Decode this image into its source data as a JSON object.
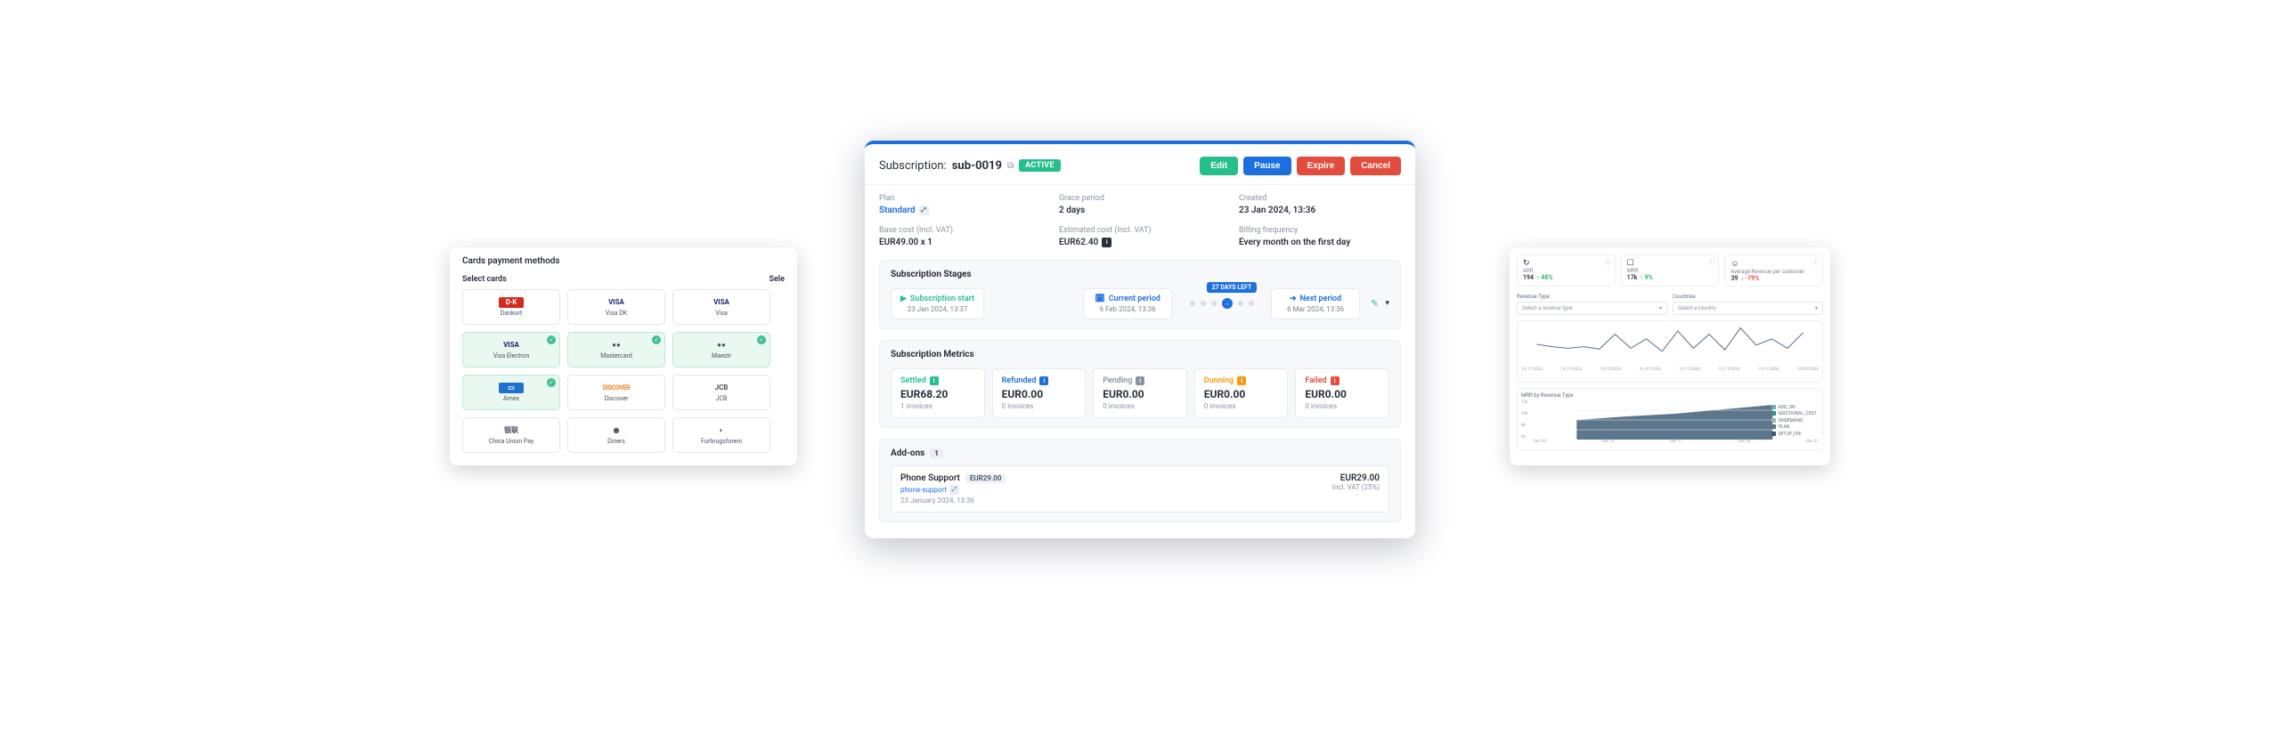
{
  "left_panel": {
    "title": "Cards payment methods",
    "select_left": "Select cards",
    "select_right": "Sele",
    "cards": [
      {
        "name": "Dankort",
        "brand": "dk",
        "selected": false
      },
      {
        "name": "Visa DK",
        "brand": "visa",
        "selected": false
      },
      {
        "name": "Visa",
        "brand": "visa",
        "selected": false,
        "cut": true
      },
      {
        "name": "Visa Electron",
        "brand": "visa",
        "selected": true
      },
      {
        "name": "Mastercard",
        "brand": "mc",
        "selected": true
      },
      {
        "name": "Maestr",
        "brand": "maestro",
        "selected": true,
        "cut": true
      },
      {
        "name": "Amex",
        "brand": "amex",
        "selected": true
      },
      {
        "name": "Discover",
        "brand": "disc",
        "selected": false
      },
      {
        "name": "JCB",
        "brand": "jcb",
        "selected": false,
        "cut": true
      },
      {
        "name": "China Union Pay",
        "brand": "cup",
        "selected": false
      },
      {
        "name": "Diners",
        "brand": "diners",
        "selected": false
      },
      {
        "name": "Forbrugsforeni",
        "brand": "fb",
        "selected": false,
        "cut": true
      }
    ]
  },
  "main": {
    "title_prefix": "Subscription:",
    "sub_id": "sub-0019",
    "status": "ACTIVE",
    "actions": {
      "edit": "Edit",
      "pause": "Pause",
      "expire": "Expire",
      "cancel": "Cancel"
    },
    "info": {
      "plan_lbl": "Plan",
      "plan_val": "Standard",
      "grace_lbl": "Grace period",
      "grace_val": "2 days",
      "created_lbl": "Created",
      "created_val": "23 Jan 2024, 13:36",
      "base_lbl": "Base cost (Incl. VAT)",
      "base_val": "EUR49.00 x 1",
      "est_lbl": "Estimated cost (Incl. VAT)",
      "est_val": "EUR62.40",
      "freq_lbl": "Billing frequency",
      "freq_val": "Every month on the first day"
    },
    "stages": {
      "title": "Subscription Stages",
      "start": {
        "label": "Subscription start",
        "date": "23 Jan 2024, 13:37"
      },
      "current": {
        "label": "Current period",
        "date": "6 Feb 2024, 13:36"
      },
      "next": {
        "label": "Next period",
        "date": "6 Mar 2024, 13:36"
      },
      "days_left": "27 DAYS LEFT"
    },
    "metrics": {
      "title": "Subscription Metrics",
      "items": [
        {
          "key": "settled",
          "label": "Settled",
          "amount": "EUR68.20",
          "sub": "1 invoices"
        },
        {
          "key": "refunded",
          "label": "Refunded",
          "amount": "EUR0.00",
          "sub": "0 invoices"
        },
        {
          "key": "pending",
          "label": "Pending",
          "amount": "EUR0.00",
          "sub": "0 invoices"
        },
        {
          "key": "dunning",
          "label": "Dunning",
          "amount": "EUR0.00",
          "sub": "0 invoices"
        },
        {
          "key": "failed",
          "label": "Failed",
          "amount": "EUR0.00",
          "sub": "0 invoices"
        }
      ]
    },
    "addons": {
      "title": "Add-ons",
      "count": "1",
      "item": {
        "name": "Phone Support",
        "chip": "EUR29.00",
        "id": "phone-support",
        "date": "23 January 2024, 13:36",
        "price": "EUR29.00",
        "vat": "Incl. VAT (25%)"
      }
    }
  },
  "right_panel": {
    "stats": [
      {
        "icon": "↻",
        "label": "ARR",
        "value": "194",
        "delta": "↑ 48%",
        "dir": "up"
      },
      {
        "icon": "☐",
        "label": "MRR",
        "value": "17k",
        "delta": "↑ 9%",
        "dir": "up"
      },
      {
        "icon": "☺",
        "label": "Average Revenue per customer",
        "value": "39",
        "delta": "↓ -79%",
        "dir": "down"
      }
    ],
    "filters": {
      "revenue_lbl": "Revenue Type",
      "revenue_ph": "Select a revenue type",
      "country_lbl": "Countries",
      "country_ph": "Select a country"
    },
    "chart2_title": "MRR by Revenue Type",
    "legend": {
      "addon": "ADD_ON",
      "additional": "ADDITIONAL_COST",
      "ondemand": "ONDEMAND",
      "plan": "PLAN",
      "setup": "SETUP_FEE"
    },
    "xticks1": [
      "13/11/2023",
      "13/11/2023",
      "12/12/2023",
      "01/01/2024",
      "13/11/2024",
      "13/11/2024",
      "13/11/2024",
      "13/02/2024"
    ],
    "xticks2": [
      "Dec 03",
      "Dec 10",
      "Dec 17",
      "Dec 24",
      "Dec 31"
    ],
    "chart_data": {
      "chart1": {
        "type": "line",
        "series": [
          {
            "name": "MRR",
            "values": [
              40,
              35,
              30,
              32,
              28,
              55,
              30,
              45,
              25,
              60,
              30,
              55,
              28,
              70,
              35,
              45
            ]
          }
        ],
        "ylim": [
          0,
          80
        ]
      },
      "chart2": {
        "type": "area",
        "categories": [
          "Dec 03",
          "Dec 10",
          "Dec 17",
          "Dec 24",
          "Dec 31"
        ],
        "series": [
          {
            "name": "PLAN",
            "values": [
              9000,
              9500,
              10000,
              11000,
              12000
            ]
          }
        ],
        "yticks": [
          "12k",
          "10k",
          "8k",
          "6k"
        ],
        "ylim": [
          5000,
          13000
        ]
      }
    }
  }
}
